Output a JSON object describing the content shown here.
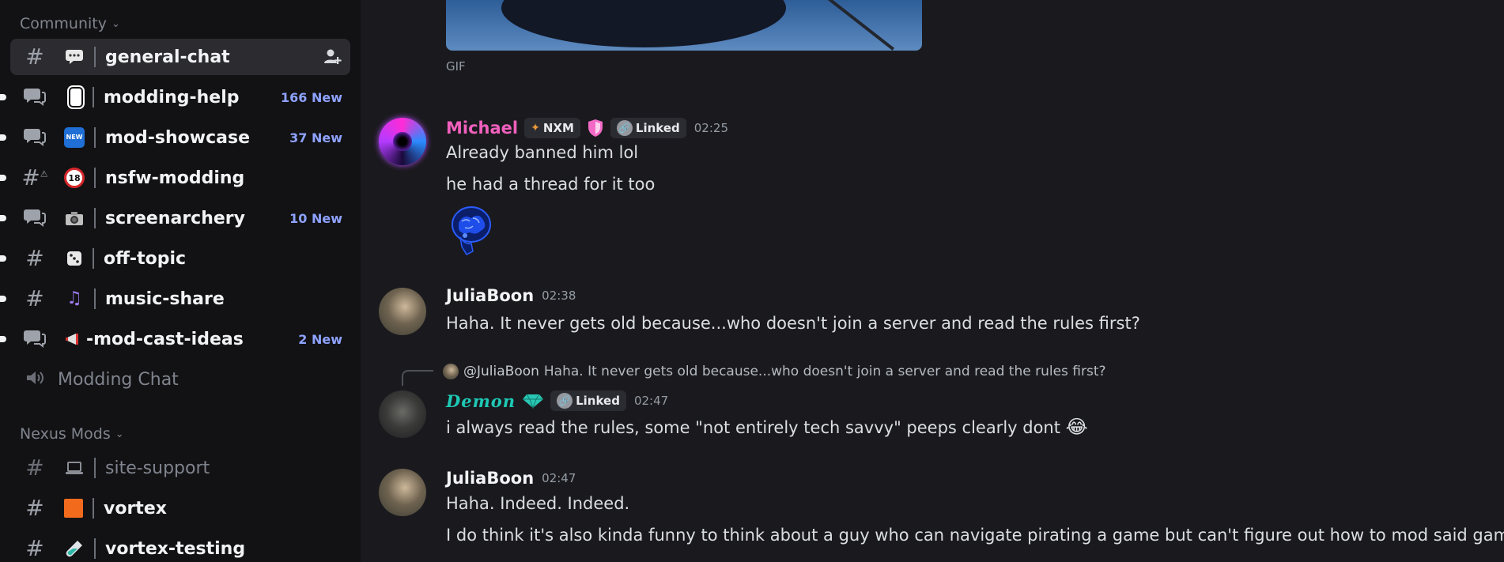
{
  "sidebar": {
    "categories": [
      {
        "label": "Community"
      },
      {
        "label": "Nexus Mods"
      }
    ],
    "channels": [
      {
        "type_icon": "#",
        "emoji": "💬",
        "name": "general-chat",
        "badge": ""
      },
      {
        "type_icon": "forum",
        "emoji": "🀆",
        "name": "modding-help",
        "badge": "166 New"
      },
      {
        "type_icon": "forum",
        "emoji": "🆕",
        "name": "mod-showcase",
        "badge": "37 New"
      },
      {
        "type_icon": "#",
        "emoji": "🔞",
        "name": "nsfw-modding",
        "badge": ""
      },
      {
        "type_icon": "forum",
        "emoji": "📷",
        "name": "screenarchery",
        "badge": "10 New"
      },
      {
        "type_icon": "#",
        "emoji": "🎲",
        "name": "off-topic",
        "badge": ""
      },
      {
        "type_icon": "#",
        "emoji": "🎶",
        "name": "music-share",
        "badge": ""
      },
      {
        "type_icon": "forum",
        "emoji": "📢",
        "name": "-mod-cast-ideas",
        "badge": "2 New"
      },
      {
        "type_icon": "voice",
        "emoji": "",
        "name": "Modding Chat",
        "badge": ""
      },
      {
        "type_icon": "#",
        "emoji": "💻",
        "name": "site-support",
        "badge": ""
      },
      {
        "type_icon": "#",
        "emoji": "🟧",
        "name": "vortex",
        "badge": ""
      },
      {
        "type_icon": "#",
        "emoji": "🧪",
        "name": "vortex-testing",
        "badge": ""
      }
    ]
  },
  "chat": {
    "gif_label": "GIF",
    "messages": [
      {
        "author": "Michael",
        "tag": "NXM",
        "linked_label": "Linked",
        "time": "02:25",
        "lines": [
          "Already banned him lol",
          "he had a thread for it too"
        ]
      },
      {
        "author": "JuliaBoon",
        "time": "02:38",
        "lines": [
          "Haha. It never gets old because...who doesn't join a server and read the rules first?"
        ]
      },
      {
        "reply_to": "@JuliaBoon",
        "reply_text": "Haha. It never gets old because...who doesn't join a server and read the rules first?",
        "author": "Demon",
        "linked_label": "Linked",
        "time": "02:47",
        "lines": [
          "i always read the rules, some \"not entirely tech savvy\" peeps clearly dont"
        ],
        "emoji": "😂"
      },
      {
        "author": "JuliaBoon",
        "time": "02:47",
        "lines": [
          "Haha. Indeed. Indeed.",
          "I do think it's also kinda funny to think about a guy who can navigate pirating a game but can't figure out how to mod said game."
        ]
      }
    ]
  },
  "colors": {
    "sidebar_bg": "#121214",
    "chat_bg": "#1a1a1e",
    "new_badge": "#8ea2ff",
    "michael_name": "#f060bd",
    "demon_name": "#1ec8b4"
  }
}
